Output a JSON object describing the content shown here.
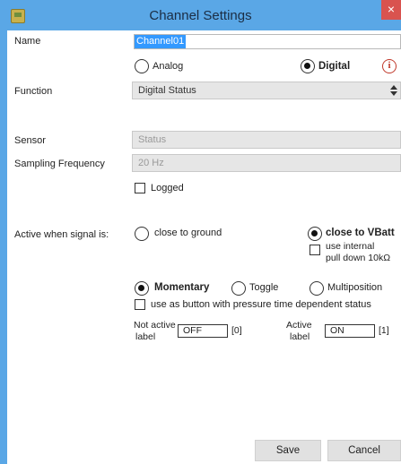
{
  "window": {
    "title": "Channel Settings",
    "close_glyph": "×",
    "titlebar_color": "#5aa7e6",
    "icon": "app-icon"
  },
  "name": {
    "label": "Name",
    "value": "Channel01"
  },
  "type": {
    "analog_label": "Analog",
    "digital_label": "Digital",
    "selected": "Digital",
    "info_glyph": "i"
  },
  "function": {
    "label": "Function",
    "value": "Digital Status"
  },
  "sensor": {
    "label": "Sensor",
    "value": "Status"
  },
  "sampling": {
    "label": "Sampling Frequency",
    "value": "20 Hz"
  },
  "logged": {
    "label": "Logged",
    "checked": false
  },
  "active_signal": {
    "label": "Active when signal is:",
    "ground_label": "close to ground",
    "vbatt_label": "close to VBatt",
    "selected": "close to VBatt",
    "pulldown_line1": "use internal",
    "pulldown_line2": "pull down 10kΩ",
    "pulldown_checked": false
  },
  "mode": {
    "momentary_label": "Momentary",
    "toggle_label": "Toggle",
    "multiposition_label": "Multiposition",
    "selected": "Momentary",
    "pressure_label": "use as button with pressure time dependent status",
    "pressure_checked": false
  },
  "labels": {
    "not_active_line1": "Not active",
    "not_active_line2": "label",
    "not_active_value": "OFF",
    "not_active_index": "[0]",
    "active_line1": "Active",
    "active_line2": "label",
    "active_value": "ON",
    "active_index": "[1]"
  },
  "buttons": {
    "save": "Save",
    "cancel": "Cancel"
  }
}
